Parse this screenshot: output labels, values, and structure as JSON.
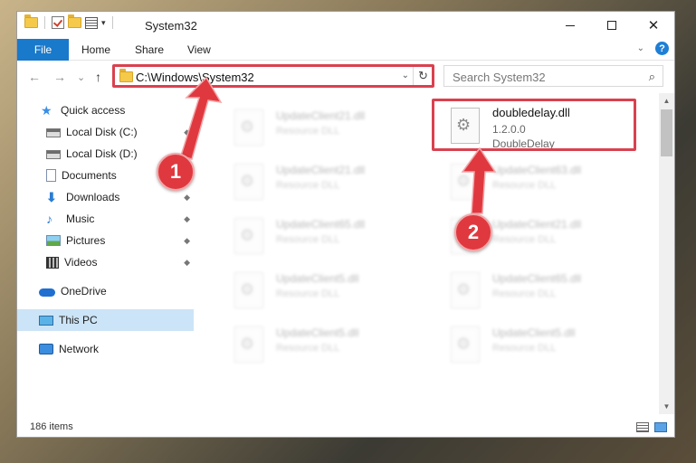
{
  "window": {
    "title": "System32",
    "controls": {
      "minimize": "─",
      "maximize": "□",
      "close": "✕"
    }
  },
  "ribbon": {
    "file_tab": "File",
    "tabs": [
      "Home",
      "Share",
      "View"
    ],
    "help": "?",
    "expand": "⌄"
  },
  "nav": {
    "back": "←",
    "forward": "→",
    "recent": "⌄",
    "up": "↑",
    "address": "C:\\Windows\\System32",
    "address_dropdown": "⌄",
    "refresh": "↻",
    "search_placeholder": "Search System32",
    "search_icon": "⌕"
  },
  "sidebar": {
    "items": [
      {
        "label": "Quick access",
        "icon": "star-icon"
      },
      {
        "label": "Local Disk (C:)",
        "icon": "drive-icon",
        "pinned": true
      },
      {
        "label": "Local Disk (D:)",
        "icon": "drive-icon"
      },
      {
        "label": "Documents",
        "icon": "documents-icon",
        "pinned": true
      },
      {
        "label": "Downloads",
        "icon": "downloads-icon",
        "pinned": true
      },
      {
        "label": "Music",
        "icon": "music-icon",
        "pinned": true
      },
      {
        "label": "Pictures",
        "icon": "pictures-icon",
        "pinned": true
      },
      {
        "label": "Videos",
        "icon": "videos-icon",
        "pinned": true
      },
      {
        "label": "OneDrive",
        "icon": "onedrive-icon"
      },
      {
        "label": "This PC",
        "icon": "this-pc-icon",
        "selected": true
      },
      {
        "label": "Network",
        "icon": "network-icon"
      }
    ],
    "pin_glyph": "📌"
  },
  "files": [
    {
      "name": "UpdateClient21.dll",
      "type": "Resource DLL"
    },
    {
      "name": "doubledelay.dll",
      "version": "1.2.0.0",
      "type": "DoubleDelay",
      "highlighted": true
    },
    {
      "name": "UpdateClient21.dll",
      "type": "Resource DLL"
    },
    {
      "name": "UpdateClient63.dll",
      "type": "Resource DLL"
    },
    {
      "name": "UpdateClient65.dll",
      "type": "Resource DLL"
    },
    {
      "name": "UpdateClient21.dll",
      "type": "Resource DLL"
    },
    {
      "name": "UpdateClient5.dll",
      "type": "Resource DLL"
    },
    {
      "name": "UpdateClient65.dll",
      "type": "Resource DLL"
    },
    {
      "name": "UpdateClient5.dll",
      "type": "Resource DLL"
    },
    {
      "name": "UpdateClient5.dll",
      "type": "Resource DLL"
    }
  ],
  "status": {
    "item_count": "186 items"
  },
  "callouts": [
    "1",
    "2"
  ],
  "colors": {
    "accent": "#1979ca",
    "highlight": "#d9414f",
    "callout": "#e0383f",
    "selected": "#cce4f7"
  }
}
